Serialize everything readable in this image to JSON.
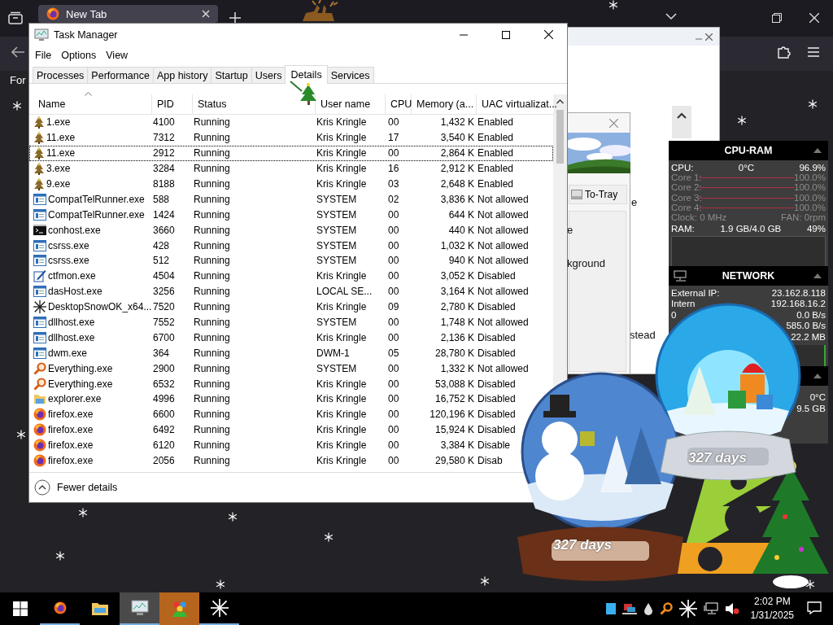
{
  "browser_window": {
    "tab_title": "New Tab",
    "side_text": "For"
  },
  "task_manager": {
    "title": "Task Manager",
    "menu": [
      "File",
      "Options",
      "View"
    ],
    "tabs": [
      {
        "label": "Processes",
        "selected": false
      },
      {
        "label": "Performance",
        "selected": false
      },
      {
        "label": "App history",
        "selected": false
      },
      {
        "label": "Startup",
        "selected": false
      },
      {
        "label": "Users",
        "selected": false
      },
      {
        "label": "Details",
        "selected": true
      },
      {
        "label": "Services",
        "selected": false
      }
    ],
    "columns": [
      {
        "label": "Name",
        "sorted": true
      },
      {
        "label": "PID",
        "sorted": false
      },
      {
        "label": "Status",
        "sorted": false
      },
      {
        "label": "User name",
        "sorted": false
      },
      {
        "label": "CPU",
        "sorted": false
      },
      {
        "label": "Memory (a...",
        "sorted": false
      },
      {
        "label": "UAC virtualizat...",
        "sorted": false
      }
    ],
    "rows": [
      {
        "kind": "tree",
        "cells": [
          "1.exe",
          "4100",
          "Running",
          "Kris Kringle",
          "00",
          "1,432 K",
          "Enabled"
        ],
        "selected": false
      },
      {
        "kind": "tree",
        "cells": [
          "11.exe",
          "7312",
          "Running",
          "Kris Kringle",
          "17",
          "3,540 K",
          "Enabled"
        ],
        "selected": false
      },
      {
        "kind": "tree",
        "cells": [
          "11.exe",
          "2912",
          "Running",
          "Kris Kringle",
          "00",
          "2,864 K",
          "Enabled"
        ],
        "selected": true
      },
      {
        "kind": "tree",
        "cells": [
          "3.exe",
          "3284",
          "Running",
          "Kris Kringle",
          "16",
          "2,912 K",
          "Enabled"
        ],
        "selected": false
      },
      {
        "kind": "tree",
        "cells": [
          "9.exe",
          "8188",
          "Running",
          "Kris Kringle",
          "03",
          "2,648 K",
          "Enabled"
        ],
        "selected": false
      },
      {
        "kind": "window",
        "cells": [
          "CompatTelRunner.exe",
          "588",
          "Running",
          "SYSTEM",
          "02",
          "3,836 K",
          "Not allowed"
        ],
        "selected": false
      },
      {
        "kind": "window",
        "cells": [
          "CompatTelRunner.exe",
          "1424",
          "Running",
          "SYSTEM",
          "00",
          "644 K",
          "Not allowed"
        ],
        "selected": false
      },
      {
        "kind": "console",
        "cells": [
          "conhost.exe",
          "3660",
          "Running",
          "SYSTEM",
          "00",
          "440 K",
          "Not allowed"
        ],
        "selected": false
      },
      {
        "kind": "window",
        "cells": [
          "csrss.exe",
          "428",
          "Running",
          "SYSTEM",
          "00",
          "1,032 K",
          "Not allowed"
        ],
        "selected": false
      },
      {
        "kind": "window",
        "cells": [
          "csrss.exe",
          "512",
          "Running",
          "SYSTEM",
          "00",
          "940 K",
          "Not allowed"
        ],
        "selected": false
      },
      {
        "kind": "pen",
        "cells": [
          "ctfmon.exe",
          "4504",
          "Running",
          "Kris Kringle",
          "00",
          "3,052 K",
          "Disabled"
        ],
        "selected": false
      },
      {
        "kind": "window",
        "cells": [
          "dasHost.exe",
          "3256",
          "Running",
          "LOCAL SE...",
          "00",
          "3,164 K",
          "Not allowed"
        ],
        "selected": false
      },
      {
        "kind": "snow",
        "cells": [
          "DesktopSnowOK_x64...",
          "7520",
          "Running",
          "Kris Kringle",
          "09",
          "2,780 K",
          "Disabled"
        ],
        "selected": false
      },
      {
        "kind": "window",
        "cells": [
          "dllhost.exe",
          "7552",
          "Running",
          "SYSTEM",
          "00",
          "1,748 K",
          "Not allowed"
        ],
        "selected": false
      },
      {
        "kind": "window",
        "cells": [
          "dllhost.exe",
          "6700",
          "Running",
          "Kris Kringle",
          "00",
          "2,136 K",
          "Disabled"
        ],
        "selected": false
      },
      {
        "kind": "window",
        "cells": [
          "dwm.exe",
          "364",
          "Running",
          "DWM-1",
          "05",
          "28,780 K",
          "Disabled"
        ],
        "selected": false
      },
      {
        "kind": "search",
        "cells": [
          "Everything.exe",
          "2900",
          "Running",
          "SYSTEM",
          "00",
          "1,332 K",
          "Not allowed"
        ],
        "selected": false
      },
      {
        "kind": "search",
        "cells": [
          "Everything.exe",
          "6532",
          "Running",
          "Kris Kringle",
          "00",
          "53,088 K",
          "Disabled"
        ],
        "selected": false
      },
      {
        "kind": "folder",
        "cells": [
          "explorer.exe",
          "4996",
          "Running",
          "Kris Kringle",
          "00",
          "16,752 K",
          "Disabled"
        ],
        "selected": false
      },
      {
        "kind": "firefox",
        "cells": [
          "firefox.exe",
          "6600",
          "Running",
          "Kris Kringle",
          "00",
          "120,196 K",
          "Disabled"
        ],
        "selected": false
      },
      {
        "kind": "firefox",
        "cells": [
          "firefox.exe",
          "6492",
          "Running",
          "Kris Kringle",
          "00",
          "15,924 K",
          "Disabled"
        ],
        "selected": false
      },
      {
        "kind": "firefox",
        "cells": [
          "firefox.exe",
          "6120",
          "Running",
          "Kris Kringle",
          "00",
          "3,384 K",
          "Disable"
        ],
        "selected": false
      },
      {
        "kind": "firefox",
        "cells": [
          "firefox.exe",
          "2056",
          "Running",
          "Kris Kringle",
          "00",
          "29,580 K",
          "Disab"
        ],
        "selected": false
      }
    ],
    "footer": "Fewer details"
  },
  "background_window": {
    "tray_button": "To-Tray",
    "dialog_fragments": [
      "e",
      "kground"
    ],
    "window_fragments": [
      "e",
      "stead"
    ]
  },
  "cpu_ram_widget": {
    "title": "CPU-RAM",
    "cpu": {
      "label": "CPU:",
      "temp": "0°C",
      "value": "96.9%"
    },
    "cores": [
      {
        "label": "Core 1:",
        "value": "100.0%"
      },
      {
        "label": "Core 2:",
        "value": "100.0%"
      },
      {
        "label": "Core 3:",
        "value": "100.0%"
      },
      {
        "label": "Core 4:",
        "value": "100.0%"
      }
    ],
    "clock": "Clock: 0 MHz",
    "fan": "FAN: 0rpm",
    "ram": {
      "label": "RAM:",
      "usage": "1.9 GB/4.0 GB",
      "value": "49%"
    }
  },
  "network_widget": {
    "title": "NETWORK",
    "rows": [
      {
        "label": "External IP:",
        "value": "23.162.8.118"
      },
      {
        "label": "Intern",
        "value": "192.168.16.2"
      },
      {
        "label": "0",
        "value": "0.0 B/s"
      },
      {
        "value": "585.0 B/s"
      },
      {
        "value": "22.2 MB"
      }
    ]
  },
  "drive_widget": {
    "rows": [
      "0°C",
      "9.5 GB"
    ]
  },
  "snow_globes": [
    {
      "kind": "snowman",
      "label": "327 days"
    },
    {
      "kind": "gifts",
      "label": "327 days"
    }
  ],
  "taskbar": {
    "apps": [
      {
        "kind": "firefox",
        "running": true,
        "hovered": false,
        "selected": false
      },
      {
        "kind": "folder",
        "running": false,
        "hovered": false,
        "selected": false
      },
      {
        "kind": "monitor",
        "running": true,
        "hovered": true,
        "selected": false
      },
      {
        "kind": "colorful",
        "running": false,
        "hovered": false,
        "selected": true
      },
      {
        "kind": "snow",
        "running": true,
        "hovered": false,
        "selected": false
      }
    ],
    "time": "2:02 PM",
    "date": "1/31/2025"
  }
}
